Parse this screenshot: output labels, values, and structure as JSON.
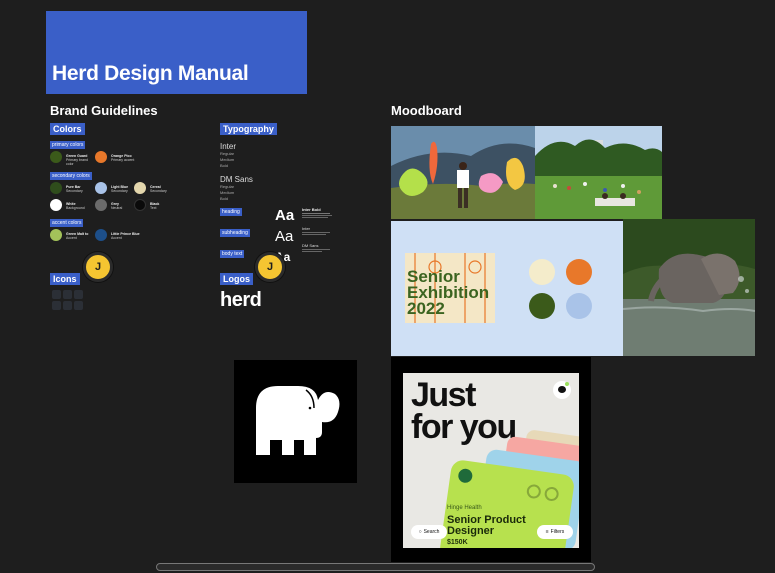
{
  "header": {
    "title": "Herd Design Manual"
  },
  "brand": {
    "title": "Brand Guidelines",
    "colors_tag": "Colors",
    "primary_label": "primary colors",
    "primary": [
      {
        "name": "Green Guard",
        "desc": "Primary brand color",
        "color": "#3b5a1a"
      },
      {
        "name": "Orange Pico",
        "desc": "Primary accent",
        "color": "#e8782a"
      }
    ],
    "secondary_label": "secondary colors",
    "secondary": [
      {
        "name": "Pure Bar",
        "desc": "Secondary",
        "color": "#2f4d1c"
      },
      {
        "name": "Light Blue",
        "desc": "Secondary",
        "color": "#a9c3e8"
      },
      {
        "name": "Cereal",
        "desc": "Secondary",
        "color": "#e3d6ac"
      },
      {
        "name": "White",
        "desc": "Background",
        "color": "#ffffff"
      },
      {
        "name": "Grey",
        "desc": "Neutral",
        "color": "#6b6b6b"
      },
      {
        "name": "Black",
        "desc": "Text",
        "color": "#0a0a0a"
      }
    ],
    "accent_label": "accent colors",
    "accent": [
      {
        "name": "Green Malt to",
        "desc": "Accent",
        "color": "#a3c25a"
      },
      {
        "name": "Little Prince Blue",
        "desc": "Accent",
        "color": "#1d4f8a"
      }
    ],
    "icons_tag": "Icons",
    "avatar_initial": "J"
  },
  "typography": {
    "tag": "Typography",
    "fonts": [
      {
        "name": "Inter",
        "weights": [
          "Regular",
          "Medium",
          "Bold"
        ]
      },
      {
        "name": "DM Sans",
        "weights": [
          "Regular",
          "Medium",
          "Bold"
        ]
      }
    ],
    "heading_tag": "heading",
    "subheading_tag": "subheading",
    "body_tag": "body text",
    "aa": "Aa",
    "specs": [
      "Inter Bold",
      "Inter",
      "DM Sans"
    ],
    "logos_tag": "Logos",
    "logo_word": "herd",
    "avatar_initial": "J"
  },
  "moodboard": {
    "title": "Moodboard",
    "senior_lines": [
      "Senior",
      "Exhibition",
      "2022"
    ],
    "palette": [
      "#f4eccb",
      "#e8782a",
      "#3b5a1a",
      "#a9c3e8"
    ],
    "jobs": {
      "big_lines": [
        "Just",
        "for you"
      ],
      "company": "Hinge Health",
      "role_lines": [
        "Senior Product",
        "Designer"
      ],
      "salary": "$150K",
      "search_label": "Search",
      "filters_label": "Filters"
    }
  }
}
